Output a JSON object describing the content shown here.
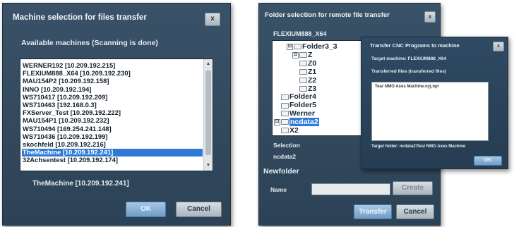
{
  "machine_dialog": {
    "title": "Machine selection for files transfer",
    "close_label": "x",
    "available_label": "Available machines (Scanning is done)",
    "machines": [
      "WERNER192 [10.209.192.215]",
      "FLEXIUM888_X64 [10.209.192.230]",
      "MAU154P2 [10.209.192.158]",
      "INNO [10.209.192.194]",
      "WS710417 [10.209.192.209]",
      "WS710463 [192.168.0.3]",
      "FXServer_Test [10.209.192.222]",
      "MAU154P1 [10.209.192.232]",
      "WS710494 [169.254.241.148]",
      "WS710436 [10.209.192.199]",
      "skochfeld [10.209.192.216]",
      "TheMachine [10.209.192.241]",
      "32Achsentest [10.209.192.174]"
    ],
    "selected_index": 11,
    "selected_label": "TheMachine [10.209.192.241]",
    "ok_label": "OK",
    "cancel_label": "Cancel"
  },
  "folder_dialog": {
    "title": "Folder selection for remote file transfer",
    "close_label": "x",
    "machine_name": "FLEXIUM888_X64",
    "tree": [
      {
        "label": "Folder3_3",
        "expander": "⊟",
        "indent": 0
      },
      {
        "label": "Z",
        "expander": "⊟",
        "indent": 1
      },
      {
        "label": "Z0",
        "expander": "",
        "indent": 2
      },
      {
        "label": "Z1",
        "expander": "",
        "indent": 2
      },
      {
        "label": "Z2",
        "expander": "",
        "indent": 2
      },
      {
        "label": "Z3",
        "expander": "",
        "indent": 2
      },
      {
        "label": "Folder4",
        "expander": "",
        "indent": -1
      },
      {
        "label": "Folder5",
        "expander": "",
        "indent": -1
      },
      {
        "label": "Werner",
        "expander": "",
        "indent": -1
      },
      {
        "label": "ncdata2",
        "expander": "⊟",
        "indent": -2,
        "selected": true
      },
      {
        "label": "X2",
        "expander": "",
        "indent": -1
      }
    ],
    "selection_label": "Selection",
    "selection_value": "ncdata2",
    "newfolder_label": "Newfolder",
    "name_label": "Name",
    "name_value": "",
    "create_label": "Create",
    "transfer_label": "Transfer",
    "cancel_label": "Cancel"
  },
  "transfer_dialog": {
    "title": "Transfer CNC Programs to machine",
    "close_label": "x",
    "target_machine": "Target machine: FLEXIUM888_X64",
    "transferred_files_label": "Transferred files (transferred files)",
    "files": "Tear NMO Axes Machine.nyj.npl",
    "target_folder": "Target folder: ncdata2\\Test NMO Axes Machine",
    "ok_label": "OK"
  }
}
